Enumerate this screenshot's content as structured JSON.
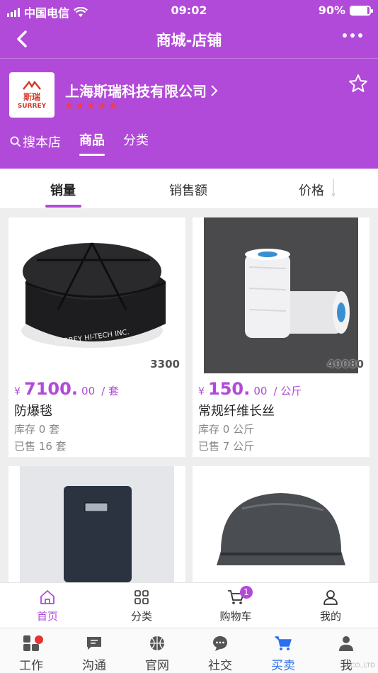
{
  "status_bar": {
    "carrier": "中国电信",
    "time": "09:02",
    "battery": "90%",
    "battery_level": 0.9
  },
  "nav": {
    "title": "商城-店铺"
  },
  "store": {
    "logo_cn": "斯瑞",
    "logo_en": "SURREY",
    "name": "上海斯瑞科技有限公司",
    "rating_stars": 5,
    "tabs": {
      "search": "搜本店",
      "products": "商品",
      "categories": "分类"
    }
  },
  "sort": {
    "sales": "销量",
    "revenue": "销售额",
    "price": "价格"
  },
  "products": [
    {
      "image_number": "3300",
      "currency": "¥",
      "price_int": "7100.",
      "price_dec": "00",
      "unit": "/ 套",
      "name": "防爆毯",
      "stock_label": "库存",
      "stock": "0",
      "stock_unit": "套",
      "sold_label": "已售",
      "sold": "16",
      "sold_unit": "套"
    },
    {
      "image_number": "40080",
      "currency": "¥",
      "price_int": "150.",
      "price_dec": "00",
      "unit": "/ 公斤",
      "name": "常规纤维长丝",
      "stock_label": "库存",
      "stock": "0",
      "stock_unit": "公斤",
      "sold_label": "已售",
      "sold": "7",
      "sold_unit": "公斤"
    }
  ],
  "tabbar": {
    "home": "首页",
    "category": "分类",
    "cart": "购物车",
    "cart_badge": "1",
    "mine": "我的"
  },
  "system_bar": {
    "work": "工作",
    "chat": "沟通",
    "website": "官网",
    "social": "社交",
    "trade": "买卖",
    "me": "我"
  },
  "watermark": "CO.,LTD",
  "colors": {
    "primary": "#b14ad8",
    "price": "#b14ad8",
    "star": "#ff3b30",
    "active_system": "#2a6ff0"
  }
}
